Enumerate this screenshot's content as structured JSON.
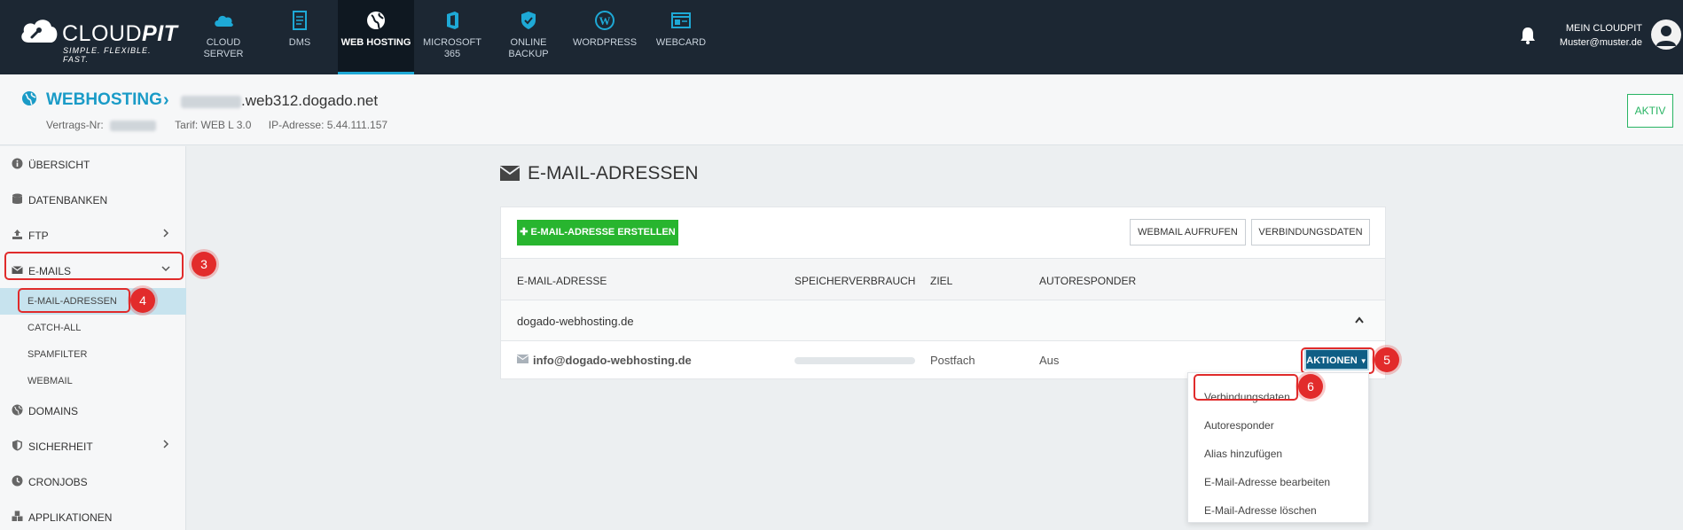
{
  "brand": {
    "name_plain": "CLOUD",
    "name_bold": "PIT",
    "tagline": "SIMPLE. FLEXIBLE. FAST."
  },
  "nav": [
    {
      "label": "CLOUD SERVER",
      "icon": "cloud-icon",
      "active": false
    },
    {
      "label": "DMS",
      "icon": "document-icon",
      "active": false
    },
    {
      "label": "WEB HOSTING",
      "icon": "globe-icon",
      "active": true
    },
    {
      "label": "MICROSOFT 365",
      "icon": "office-icon",
      "active": false
    },
    {
      "label": "ONLINE BACKUP",
      "icon": "shield-icon",
      "active": false
    },
    {
      "label": "WORDPRESS",
      "icon": "wordpress-icon",
      "active": false
    },
    {
      "label": "WEBCARD",
      "icon": "webcard-icon",
      "active": false
    }
  ],
  "account": {
    "label": "MEIN CLOUDPIT",
    "email": "Muster@muster.de"
  },
  "header": {
    "title": "WEBHOSTING",
    "domain_suffix": ".web312.dogado.net",
    "contract_label": "Vertrags-Nr:",
    "tariff": "Tarif: WEB L 3.0",
    "ip": "IP-Adresse: 5.44.111.157",
    "status": "AKTIV"
  },
  "sidebar": {
    "items": [
      {
        "label": "ÜBERSICHT",
        "icon": "info-icon"
      },
      {
        "label": "DATENBANKEN",
        "icon": "database-icon"
      },
      {
        "label": "FTP",
        "icon": "upload-icon"
      },
      {
        "label": "E-MAILS",
        "icon": "envelope-icon"
      },
      {
        "label": "DOMAINS",
        "icon": "globe-icon"
      },
      {
        "label": "SICHERHEIT",
        "icon": "shield-icon"
      },
      {
        "label": "CRONJOBS",
        "icon": "clock-icon"
      },
      {
        "label": "APPLIKATIONEN",
        "icon": "apps-icon"
      }
    ],
    "email_sub": [
      {
        "label": "E-MAIL-ADRESSEN"
      },
      {
        "label": "CATCH-ALL"
      },
      {
        "label": "SPAMFILTER"
      },
      {
        "label": "WEBMAIL"
      }
    ]
  },
  "annotations": {
    "step3": "3",
    "step4": "4",
    "step5": "5",
    "step6": "6"
  },
  "main": {
    "title": "E-MAIL-ADRESSEN",
    "create_button": "E-MAIL-ADRESSE ERSTELLEN",
    "webmail_button": "WEBMAIL AUFRUFEN",
    "connection_button": "VERBINDUNGSDATEN",
    "columns": [
      "E-MAIL-ADRESSE",
      "SPEICHERVERBRAUCH",
      "ZIEL",
      "AUTORESPONDER"
    ],
    "group_domain": "dogado-webhosting.de",
    "row": {
      "email": "info@dogado-webhosting.de",
      "target": "Postfach",
      "autoresponder": "Aus",
      "actions_label": "AKTIONEN"
    },
    "dropdown": [
      "Verbindungsdaten",
      "Autoresponder",
      "Alias hinzufügen",
      "E-Mail-Adresse bearbeiten",
      "E-Mail-Adresse löschen"
    ]
  },
  "colors": {
    "topbar": "#1c2733",
    "accent": "#1a9bc7",
    "create_green": "#28b52f",
    "actions_blue": "#0f5e85",
    "annotation_red": "#e22b2b"
  }
}
